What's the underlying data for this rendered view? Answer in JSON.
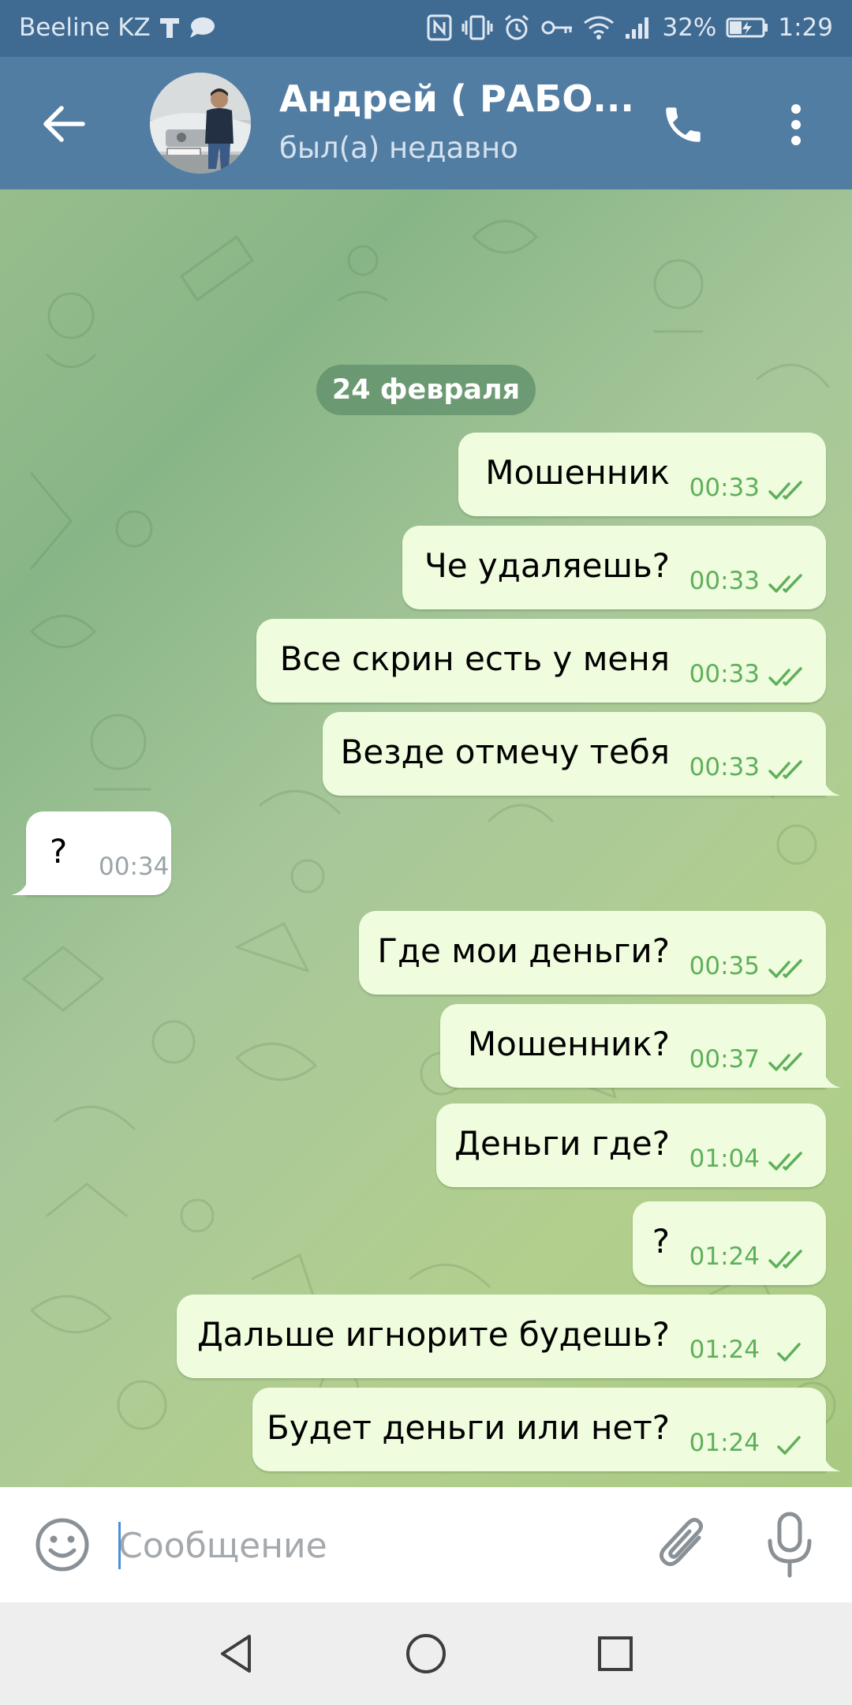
{
  "status_bar": {
    "carrier": "Beeline KZ",
    "battery": "32%",
    "time": "1:29"
  },
  "header": {
    "title": "Андрей ( РАБО...",
    "status": "был(а) недавно"
  },
  "chat": {
    "date_chip": "24 февраля",
    "messages": [
      {
        "direction": "out",
        "text": "Мошенник",
        "time": "00:33",
        "read": true
      },
      {
        "direction": "out",
        "text": "Че удаляешь?",
        "time": "00:33",
        "read": true
      },
      {
        "direction": "out",
        "text": "Все скрин есть у меня",
        "time": "00:33",
        "read": true
      },
      {
        "direction": "out",
        "text": "Везде отмечу тебя",
        "time": "00:33",
        "read": true
      },
      {
        "direction": "in",
        "text": "?",
        "time": "00:34"
      },
      {
        "direction": "out",
        "text": "Где мои деньги?",
        "time": "00:35",
        "read": true
      },
      {
        "direction": "out",
        "text": "Мошенник?",
        "time": "00:37",
        "read": true
      },
      {
        "direction": "out",
        "text": "Деньги где?",
        "time": "01:04",
        "read": true
      },
      {
        "direction": "out",
        "text": "?",
        "time": "01:24",
        "read": true
      },
      {
        "direction": "out",
        "text": "Дальше игнорите будешь?",
        "time": "01:24",
        "read": false
      },
      {
        "direction": "out",
        "text": "Будет деньги или нет?",
        "time": "01:24",
        "read": false
      }
    ]
  },
  "composer": {
    "placeholder": "Сообщение"
  },
  "colors": {
    "header_bg": "#527da3",
    "status_bar_bg": "#3f6a92",
    "outgoing_bubble": "#effdde",
    "incoming_bubble": "#ffffff",
    "read_check": "#5faf5b"
  }
}
